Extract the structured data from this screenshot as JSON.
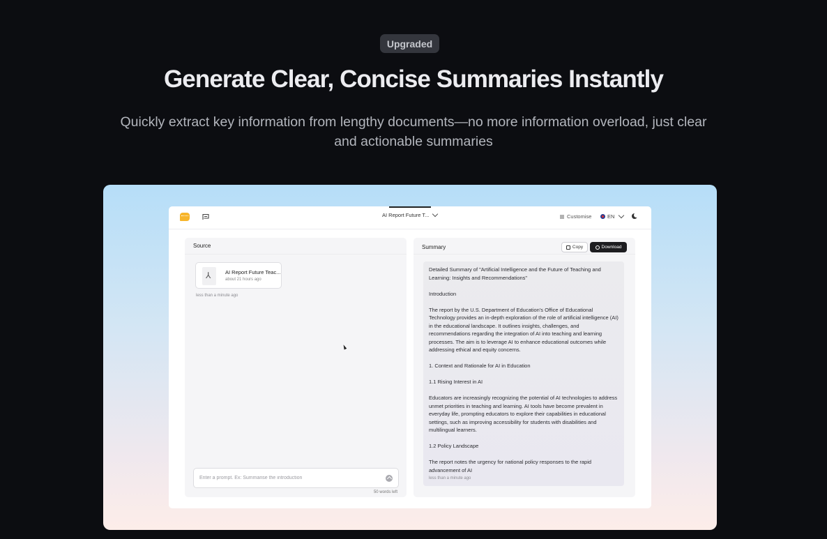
{
  "hero": {
    "badge": "Upgraded",
    "title": "Generate Clear, Concise Summaries Instantly",
    "subtitle": "Quickly extract key information from lengthy documents—no more information overload, just clear and actionable summaries"
  },
  "app": {
    "topbar": {
      "doc_tab_label": "AI Report Future T...",
      "customise_label": "Customise",
      "language": "EN"
    },
    "source": {
      "title": "Source",
      "file_name": "AI Report Future Teac...",
      "file_time": "about 21 hours ago",
      "source_time": "less than a minute ago",
      "prompt_placeholder": "Enter a prompt. Ex: Summarise the introduction",
      "words_left": "50 words left"
    },
    "summary": {
      "title": "Summary",
      "copy_label": "Copy",
      "download_label": "Download",
      "paragraphs": [
        "Detailed Summary of \"Artificial Intelligence and the Future of Teaching and Learning: Insights and Recommendations\"",
        "Introduction",
        "The report by the U.S. Department of Education's Office of Educational Technology provides an in-depth exploration of the role of artificial intelligence (AI) in the educational landscape. It outlines insights, challenges, and recommendations regarding the integration of AI into teaching and learning processes. The aim is to leverage AI to enhance educational outcomes while addressing ethical and equity concerns.",
        "1. Context and Rationale for AI in Education",
        "1.1 Rising Interest in AI",
        "Educators are increasingly recognizing the potential of AI technologies to address unmet priorities in teaching and learning. AI tools have become prevalent in everyday life, prompting educators to explore their capabilities in educational settings, such as improving accessibility for students with disabilities and multilingual learners.",
        "1.2 Policy Landscape",
        "The report notes the urgency for national policy responses to the rapid advancement of AI"
      ],
      "time": "less than a minute ago"
    }
  }
}
